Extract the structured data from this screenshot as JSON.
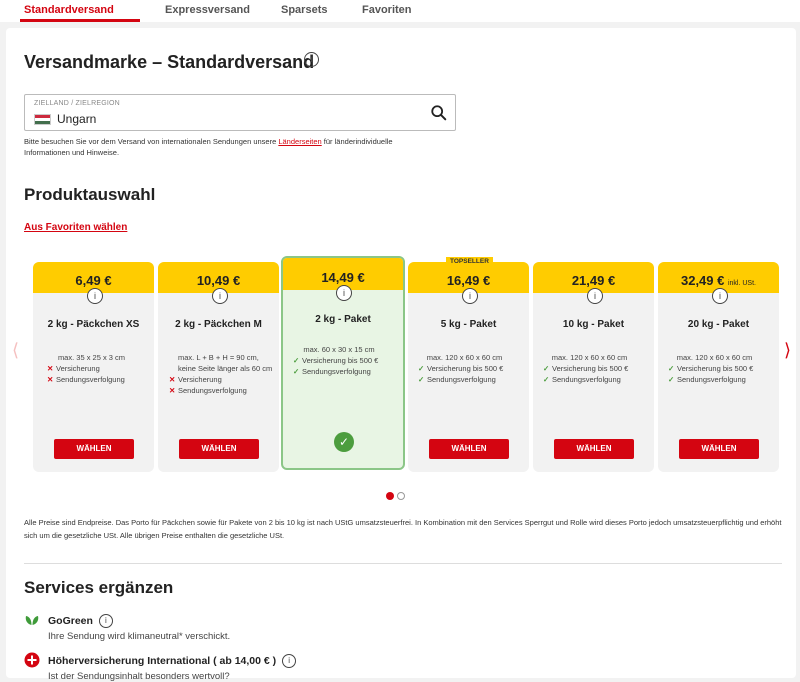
{
  "tabs": [
    {
      "label": "Standardversand",
      "active": true
    },
    {
      "label": "Expressversand",
      "active": false
    },
    {
      "label": "Sparsets",
      "active": false
    },
    {
      "label": "Favoriten",
      "active": false
    }
  ],
  "page_title": "Versandmarke – Standardversand",
  "destination": {
    "label": "ZIELLAND / ZIELREGION",
    "value": "Ungarn",
    "hint_prefix": "Bitte besuchen Sie vor dem Versand von internationalen Sendungen unsere ",
    "hint_link": "Länderseiten",
    "hint_suffix": " für länderindividuelle Informationen und Hinweise."
  },
  "product_section": {
    "title": "Produktauswahl",
    "favorites_link": "Aus Favoriten wählen"
  },
  "products": [
    {
      "price": "6,49 €",
      "name": "2 kg - Päckchen XS",
      "dims": "max. 35 x 25 x 3 cm",
      "features": [
        {
          "ok": false,
          "text": "Versicherung"
        },
        {
          "ok": false,
          "text": "Sendungsverfolgung"
        }
      ],
      "button": "WÄHLEN"
    },
    {
      "price": "10,49 €",
      "name": "2 kg - Päckchen M",
      "dims": "max. L + B + H = 90 cm, keine Seite länger als 60 cm",
      "features": [
        {
          "ok": false,
          "text": "Versicherung"
        },
        {
          "ok": false,
          "text": "Sendungsverfolgung"
        }
      ],
      "button": "WÄHLEN"
    },
    {
      "price": "14,49 €",
      "name": "2 kg - Paket",
      "dims": "max. 60 x 30 x 15 cm",
      "features": [
        {
          "ok": true,
          "text": "Versicherung bis 500 €"
        },
        {
          "ok": true,
          "text": "Sendungsverfolgung"
        }
      ],
      "selected": true
    },
    {
      "price": "16,49 €",
      "badge": "TOPSELLER",
      "name": "5 kg - Paket",
      "dims": "max. 120 x 60 x 60 cm",
      "features": [
        {
          "ok": true,
          "text": "Versicherung bis 500 €"
        },
        {
          "ok": true,
          "text": "Sendungsverfolgung"
        }
      ],
      "button": "WÄHLEN"
    },
    {
      "price": "21,49 €",
      "name": "10 kg - Paket",
      "dims": "max. 120 x 60 x 60 cm",
      "features": [
        {
          "ok": true,
          "text": "Versicherung bis 500 €"
        },
        {
          "ok": true,
          "text": "Sendungsverfolgung"
        }
      ],
      "button": "WÄHLEN"
    },
    {
      "price": "32,49 €",
      "price_suffix": "inkl. USt.",
      "name": "20 kg - Paket",
      "dims": "max. 120 x 60 x 60 cm",
      "features": [
        {
          "ok": true,
          "text": "Versicherung bis 500 €"
        },
        {
          "ok": true,
          "text": "Sendungsverfolgung"
        }
      ],
      "button": "WÄHLEN"
    }
  ],
  "price_note": "Alle Preise sind Endpreise. Das Porto für Päckchen sowie für Pakete von 2 bis 10 kg ist nach UStG umsatzsteuerfrei. In Kombination mit den Services Sperrgut und Rolle wird dieses Porto jedoch umsatzsteuerpflichtig und erhöht sich um die gesetzliche USt. Alle übrigen Preise enthalten die gesetzliche USt.",
  "services": {
    "title": "Services ergänzen",
    "items": [
      {
        "title": "GoGreen",
        "desc": "Ihre Sendung wird klimaneutral* verschickt."
      },
      {
        "title": "Höherversicherung International ( ab 14,00 € )",
        "desc": "Ist der Sendungsinhalt besonders wertvoll?"
      }
    ]
  },
  "icons": {
    "info": "info-icon",
    "search": "search-icon",
    "flag": "hungary-flag-icon",
    "leaf": "leaf-icon",
    "plus": "plus-circle-icon",
    "check": "check-icon",
    "cross": "cross-icon"
  },
  "colors": {
    "accent": "#d40511",
    "yellow": "#ffcc00",
    "selected_bg": "#e8f5e4",
    "success": "#4c9d3e"
  },
  "carousel": {
    "pages": 2,
    "current": 1
  }
}
